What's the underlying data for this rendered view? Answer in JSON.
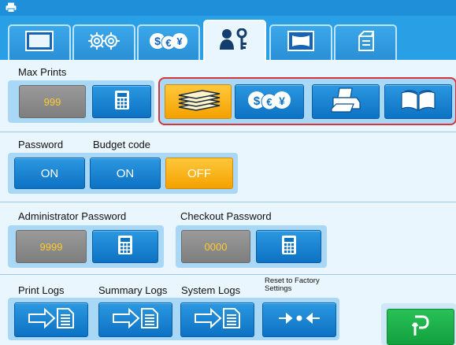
{
  "app": {
    "icon": "printer-icon"
  },
  "tabs": [
    {
      "name": "tab-display",
      "icon": "screen-icon"
    },
    {
      "name": "tab-settings",
      "icon": "gears-icon"
    },
    {
      "name": "tab-currency",
      "icon": "currency-icon"
    },
    {
      "name": "tab-admin",
      "icon": "user-key-icon",
      "active": true
    },
    {
      "name": "tab-frame",
      "icon": "frame-icon"
    },
    {
      "name": "tab-storage",
      "icon": "drive-icon"
    }
  ],
  "max_prints": {
    "label": "Max Prints",
    "value": "999",
    "options": [
      {
        "name": "paper-stack-option",
        "icon": "paper-stack-icon",
        "selected": true
      },
      {
        "name": "currency-option",
        "icon": "currency-icon",
        "selected": false
      },
      {
        "name": "printer-option",
        "icon": "printer-icon",
        "selected": false
      },
      {
        "name": "album-option",
        "icon": "album-icon",
        "selected": false
      }
    ]
  },
  "password": {
    "label": "Password",
    "on_label": "ON"
  },
  "budget_code": {
    "label": "Budget code",
    "on_label": "ON",
    "off_label": "OFF",
    "selected": "OFF"
  },
  "admin_password": {
    "label": "Administrator Password",
    "value": "9999"
  },
  "checkout_password": {
    "label": "Checkout Password",
    "value": "0000"
  },
  "logs": {
    "print_label": "Print Logs",
    "summary_label": "Summary Logs",
    "system_label": "System Logs",
    "reset_label": "Reset to Factory Settings"
  },
  "colors": {
    "accent_blue": "#0d72c4",
    "selected_orange": "#f4a100",
    "value_yellow": "#ffcb2e",
    "highlight_red": "#d8353a",
    "confirm_green": "#12a03e"
  }
}
